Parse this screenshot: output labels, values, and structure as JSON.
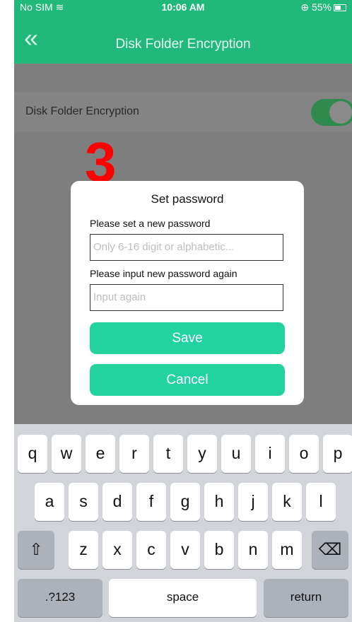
{
  "status_bar": {
    "carrier": "No SIM",
    "time": "10:06 AM",
    "battery": "55%"
  },
  "nav": {
    "back_icon": "double-chevron-left-icon",
    "title": "Disk Folder Encryption"
  },
  "setting": {
    "label": "Disk Folder Encryption",
    "toggle_on": true
  },
  "step_marker": "3",
  "dialog": {
    "title": "Set password",
    "new_password_label": "Please set a new password",
    "new_password_placeholder": "Only 6-16 digit or alphabetic...",
    "confirm_label": "Please input new password again",
    "confirm_placeholder": "Input again",
    "save_label": "Save",
    "cancel_label": "Cancel"
  },
  "keyboard": {
    "row1": [
      "q",
      "w",
      "e",
      "r",
      "t",
      "y",
      "u",
      "i",
      "o",
      "p"
    ],
    "row2": [
      "a",
      "s",
      "d",
      "f",
      "g",
      "h",
      "j",
      "k",
      "l"
    ],
    "row3": [
      "z",
      "x",
      "c",
      "v",
      "b",
      "n",
      "m"
    ],
    "numbers_label": ".?123",
    "space_label": "space",
    "return_label": "return"
  },
  "colors": {
    "accent": "#20b87b",
    "button": "#22d3a0",
    "marker": "#ff0000"
  }
}
